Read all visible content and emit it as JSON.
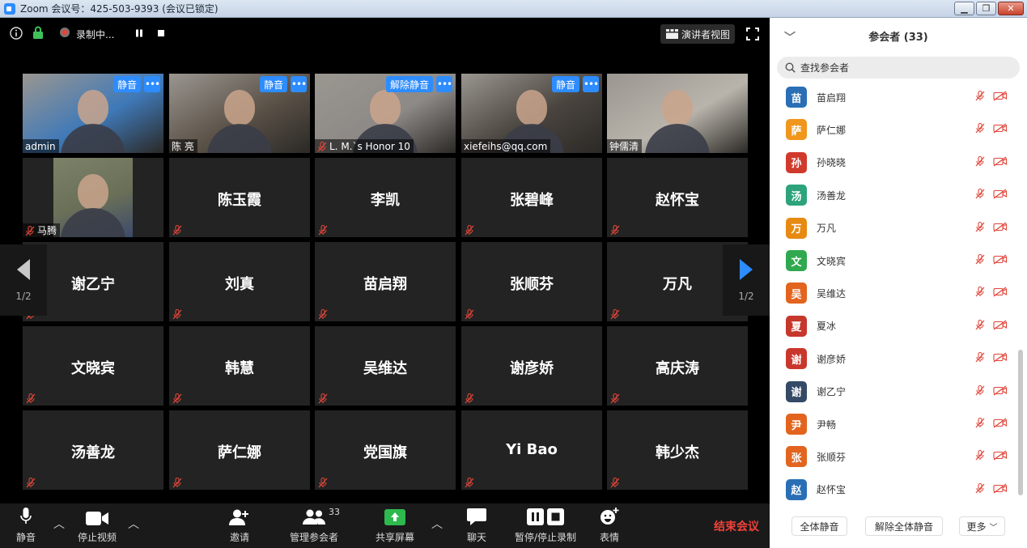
{
  "window": {
    "title": "Zoom 会议号：425-503-9393  (会议已锁定)"
  },
  "topbar": {
    "recording_label": "录制中...",
    "speaker_view_label": "演讲者视图"
  },
  "tiles": [
    {
      "label": "admin",
      "video": true,
      "mute_btn": "静音",
      "more": "•••",
      "highlight": true,
      "bg": "#3f79b8"
    },
    {
      "label": "陈 亮",
      "video": true,
      "mute_btn": "静音",
      "more": "•••",
      "bg": "#5b5248"
    },
    {
      "label": "L. M.`s Honor 10",
      "video": true,
      "mute_btn": "解除静音",
      "more": "•••",
      "muted": true,
      "bg": "#8d8986"
    },
    {
      "label": "xiefeihs@qq.com",
      "video": true,
      "mute_btn": "静音",
      "more": "•••",
      "bg": "#4a443f"
    },
    {
      "label": "钟儒清",
      "video": true,
      "bg": "#b9b4ab"
    },
    {
      "label": "马腾",
      "video": true,
      "muted": true,
      "bg": "#6a6f58",
      "small_frame": true
    },
    {
      "name": "陈玉霞"
    },
    {
      "name": "李凯"
    },
    {
      "name": "张碧峰"
    },
    {
      "name": "赵怀宝"
    },
    {
      "name": "谢乙宁"
    },
    {
      "name": "刘真"
    },
    {
      "name": "苗启翔"
    },
    {
      "name": "张顺芬"
    },
    {
      "name": "万凡"
    },
    {
      "name": "文晓宾"
    },
    {
      "name": "韩慧"
    },
    {
      "name": "吴维达"
    },
    {
      "name": "谢彦娇"
    },
    {
      "name": "高庆涛"
    },
    {
      "name": "汤善龙"
    },
    {
      "name": "萨仁娜"
    },
    {
      "name": "党国旗"
    },
    {
      "name": "Yi Bao"
    },
    {
      "name": "韩少杰"
    }
  ],
  "pager": {
    "left": "1/2",
    "right": "1/2"
  },
  "toolbar": {
    "mute": "静音",
    "stop_video": "停止视频",
    "invite": "邀请",
    "manage": "管理参会者",
    "participant_count": "33",
    "share": "共享屏幕",
    "chat": "聊天",
    "record": "暂停/停止录制",
    "reactions": "表情",
    "end": "结束会议"
  },
  "panel": {
    "title": "参会者 (33)",
    "search_placeholder": "查找参会者",
    "participants": [
      {
        "initial": "苗",
        "name": "苗启翔",
        "color": "#2a6fb5"
      },
      {
        "initial": "萨",
        "name": "萨仁娜",
        "color": "#f0961c"
      },
      {
        "initial": "孙",
        "name": "孙晓晓",
        "color": "#d03a2c"
      },
      {
        "initial": "汤",
        "name": "汤善龙",
        "color": "#2ca37a"
      },
      {
        "initial": "万",
        "name": "万凡",
        "color": "#e78a12"
      },
      {
        "initial": "文",
        "name": "文晓宾",
        "color": "#2fa84f"
      },
      {
        "initial": "吴",
        "name": "吴维达",
        "color": "#e2641e"
      },
      {
        "initial": "夏",
        "name": "夏冰",
        "color": "#c6372c"
      },
      {
        "initial": "谢",
        "name": "谢彦娇",
        "color": "#c9372c"
      },
      {
        "initial": "谢",
        "name": "谢乙宁",
        "color": "#344a66"
      },
      {
        "initial": "尹",
        "name": "尹畅",
        "color": "#e2641e"
      },
      {
        "initial": "张",
        "name": "张顺芬",
        "color": "#e2641e"
      },
      {
        "initial": "赵",
        "name": "赵怀宝",
        "color": "#2a6fb5"
      }
    ],
    "footer": {
      "mute_all": "全体静音",
      "unmute_all": "解除全体静音",
      "more": "更多"
    }
  }
}
